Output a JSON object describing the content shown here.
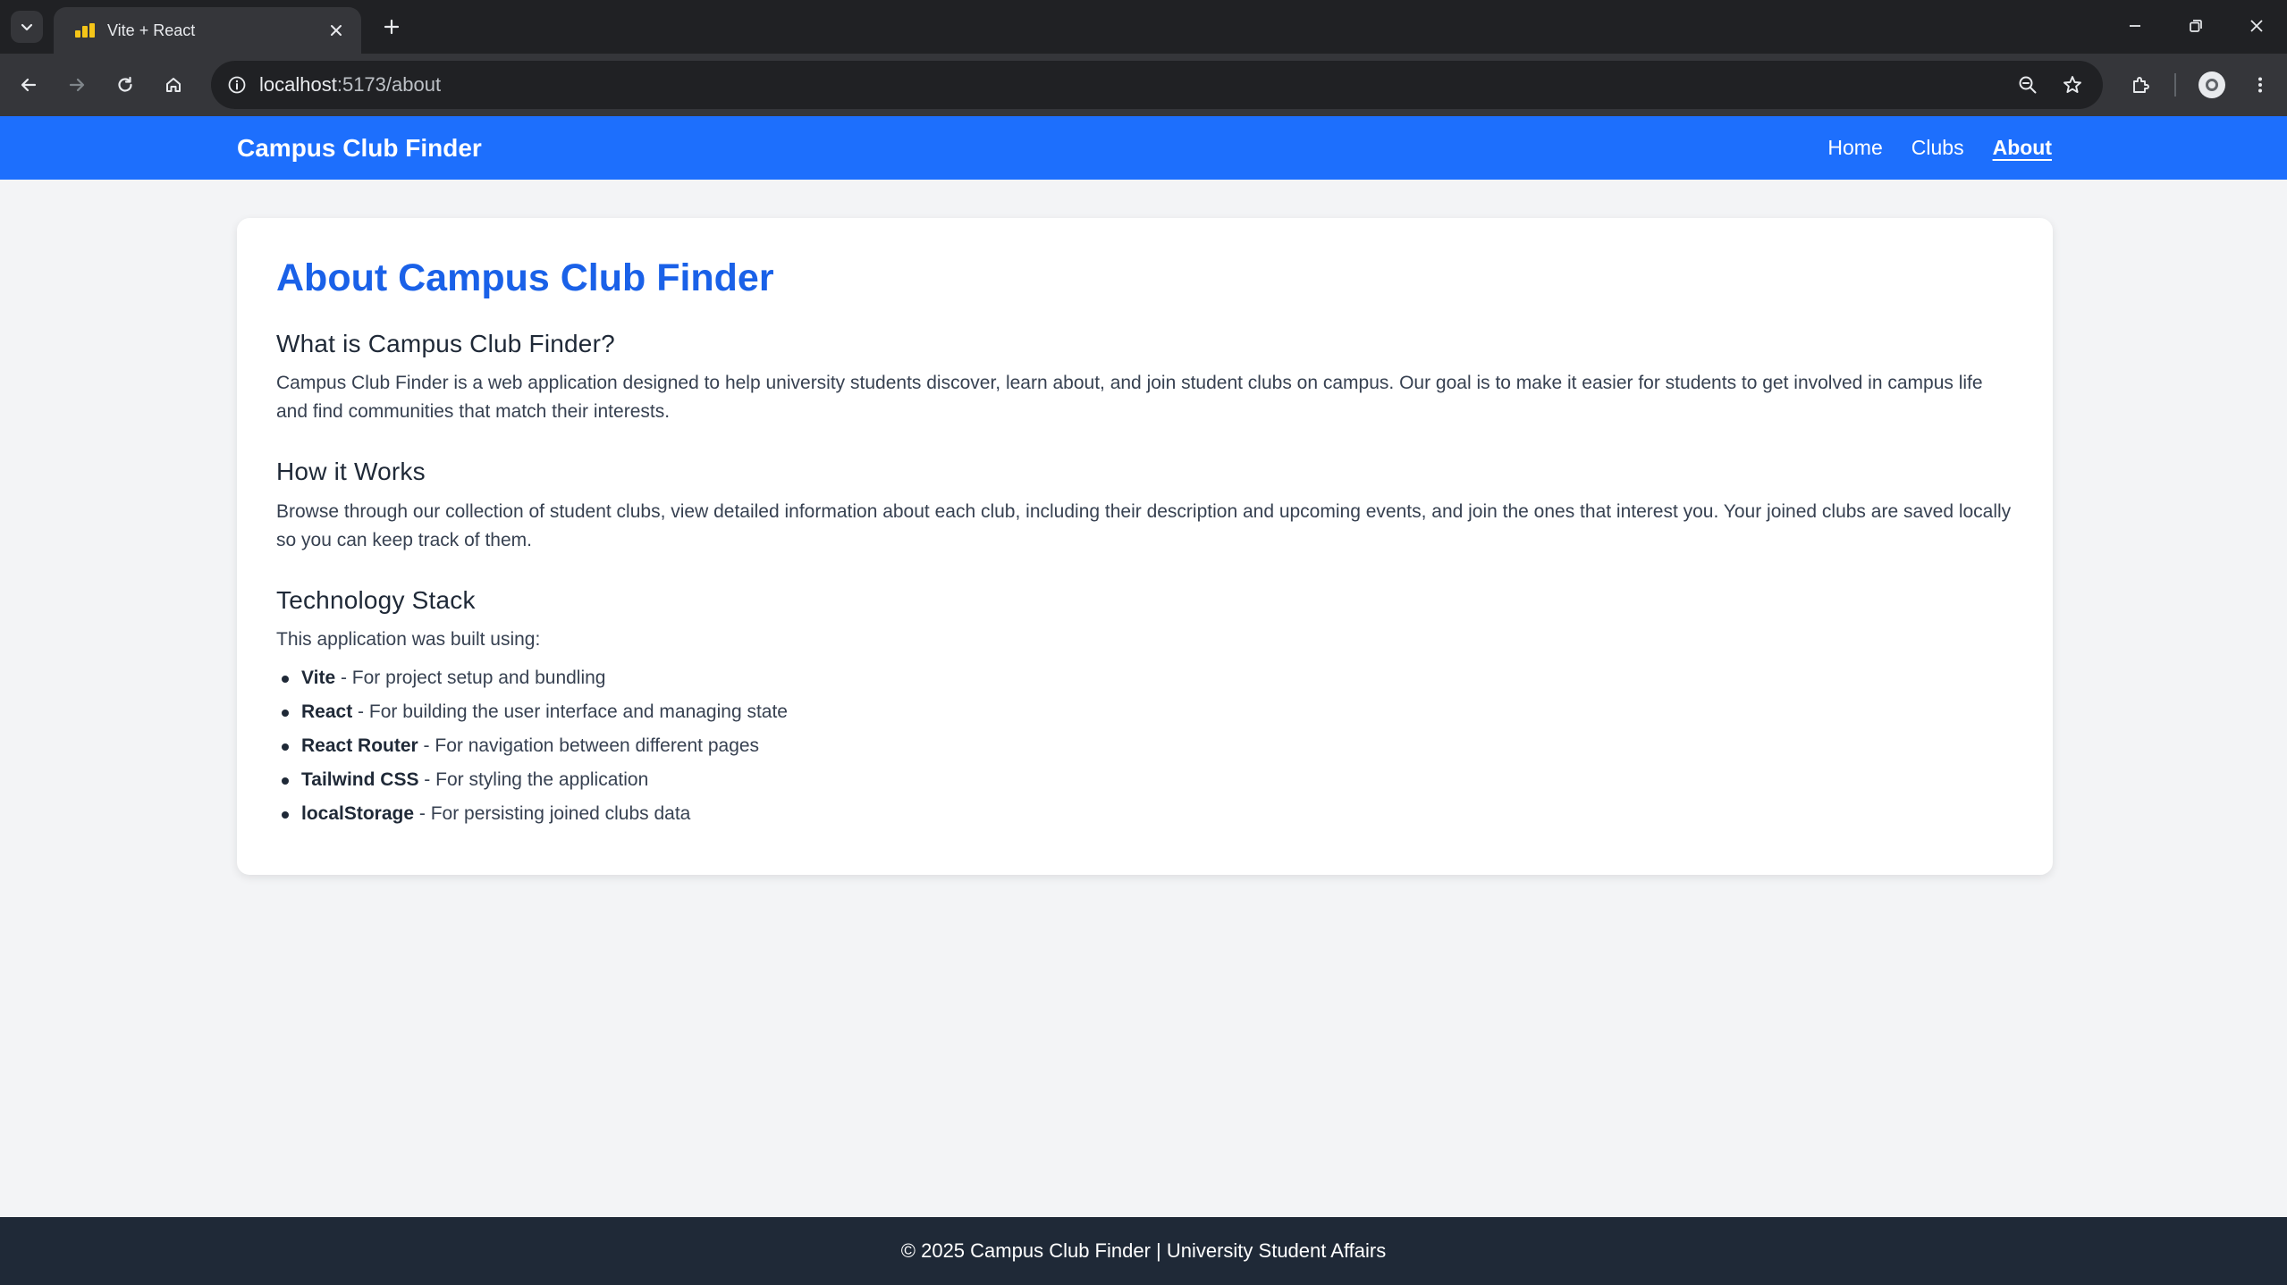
{
  "browser": {
    "tab_title": "Vite + React",
    "url_host": "localhost",
    "url_path": ":5173/about"
  },
  "nav": {
    "brand": "Campus Club Finder",
    "links": [
      {
        "label": "Home",
        "active": false
      },
      {
        "label": "Clubs",
        "active": false
      },
      {
        "label": "About",
        "active": true
      }
    ]
  },
  "about": {
    "title": "About Campus Club Finder",
    "sections": [
      {
        "heading": "What is Campus Club Finder?",
        "body": "Campus Club Finder is a web application designed to help university students discover, learn about, and join student clubs on campus. Our goal is to make it easier for students to get involved in campus life and find communities that match their interests."
      },
      {
        "heading": "How it Works",
        "body": "Browse through our collection of student clubs, view detailed information about each club, including their description and upcoming events, and join the ones that interest you. Your joined clubs are saved locally so you can keep track of them."
      },
      {
        "heading": "Technology Stack",
        "body": "This application was built using:"
      }
    ],
    "stack": [
      {
        "name": "Vite",
        "desc": " - For project setup and bundling"
      },
      {
        "name": "React",
        "desc": " - For building the user interface and managing state"
      },
      {
        "name": "React Router",
        "desc": " - For navigation between different pages"
      },
      {
        "name": "Tailwind CSS",
        "desc": " - For styling the application"
      },
      {
        "name": "localStorage",
        "desc": " - For persisting joined clubs data"
      }
    ]
  },
  "footer": {
    "text": "© 2025 Campus Club Finder | University Student Affairs"
  },
  "colors": {
    "brand_blue": "#1d6ffd",
    "title_blue": "#1a61e8",
    "footer_bg": "#1f2937"
  }
}
